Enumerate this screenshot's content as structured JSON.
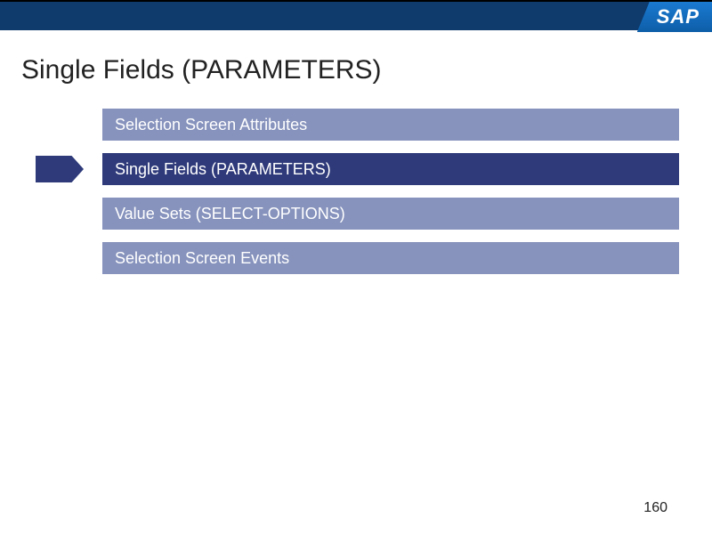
{
  "logo": "SAP",
  "title": "Single Fields (PARAMETERS)",
  "items": [
    {
      "label": "Selection Screen Attributes",
      "active": false
    },
    {
      "label": "Single Fields (PARAMETERS)",
      "active": true
    },
    {
      "label": "Value Sets (SELECT-OPTIONS)",
      "active": false
    },
    {
      "label": "Selection Screen Events",
      "active": false
    }
  ],
  "page_number": "160"
}
